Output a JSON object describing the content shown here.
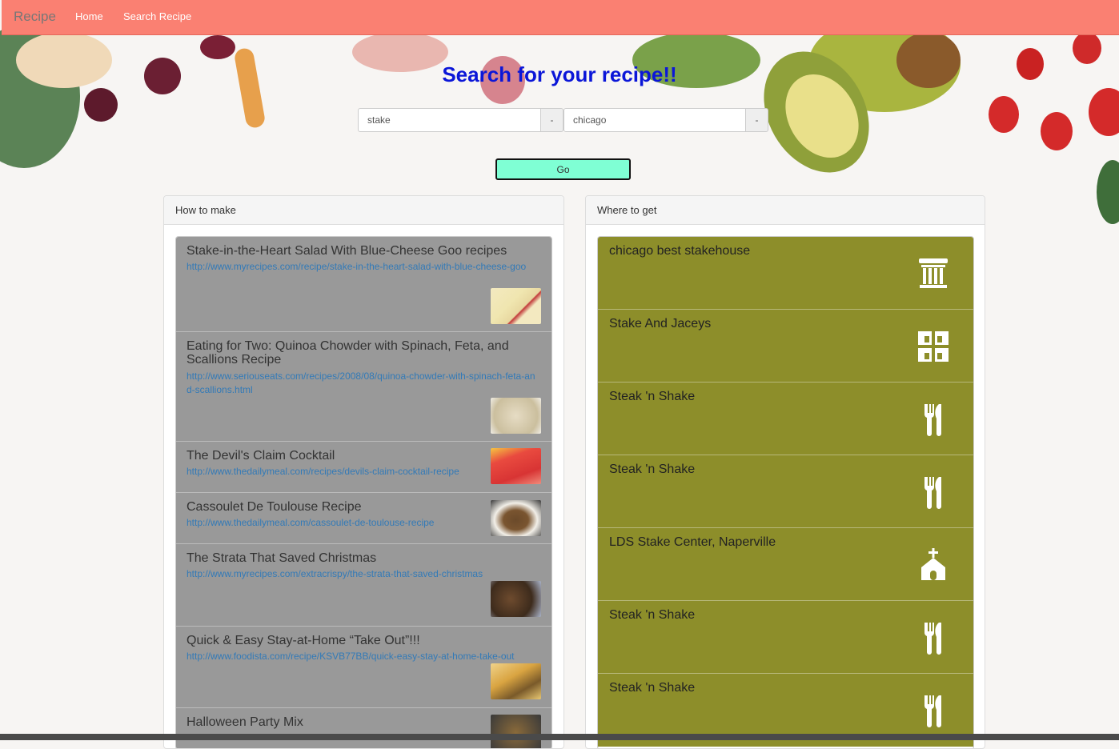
{
  "nav": {
    "brand": "Recipe",
    "links": [
      "Home",
      "Search Recipe"
    ],
    "bg_color": "#fa8072"
  },
  "search": {
    "title": "Search for your recipe!!",
    "query_value": "stake",
    "location_value": "chicago",
    "addon_label": "-",
    "go_label": "Go"
  },
  "how_to_make": {
    "heading": "How to make",
    "items": [
      {
        "title": "Stake-in-the-Heart Salad With Blue-Cheese Goo recipes",
        "url": "http://www.myrecipes.com/recipe/stake-in-the-heart-salad-with-blue-cheese-goo"
      },
      {
        "title": "Eating for Two: Quinoa Chowder with Spinach, Feta, and Scallions Recipe",
        "url": "http://www.seriouseats.com/recipes/2008/08/quinoa-chowder-with-spinach-feta-and-scallions.html"
      },
      {
        "title": "The Devil's Claim Cocktail",
        "url": "http://www.thedailymeal.com/recipes/devils-claim-cocktail-recipe"
      },
      {
        "title": "Cassoulet De Toulouse Recipe",
        "url": "http://www.thedailymeal.com/cassoulet-de-toulouse-recipe"
      },
      {
        "title": "The Strata That Saved Christmas",
        "url": "http://www.myrecipes.com/extracrispy/the-strata-that-saved-christmas"
      },
      {
        "title": "Quick & Easy Stay-at-Home “Take Out”!!!",
        "url": "http://www.foodista.com/recipe/KSVB77BB/quick-easy-stay-at-home-take-out"
      },
      {
        "title": "Halloween Party Mix",
        "url": ""
      }
    ]
  },
  "where_to_get": {
    "heading": "Where to get",
    "item_color": "#8d8e2a",
    "items": [
      {
        "name": "chicago best stakehouse",
        "icon": "museum-icon"
      },
      {
        "name": "Stake And Jaceys",
        "icon": "building-icon"
      },
      {
        "name": "Steak 'n Shake",
        "icon": "restaurant-icon"
      },
      {
        "name": "Steak 'n Shake",
        "icon": "restaurant-icon"
      },
      {
        "name": "LDS Stake Center, Naperville",
        "icon": "church-icon"
      },
      {
        "name": "Steak 'n Shake",
        "icon": "restaurant-icon"
      },
      {
        "name": "Steak 'n Shake",
        "icon": "restaurant-icon"
      }
    ]
  }
}
